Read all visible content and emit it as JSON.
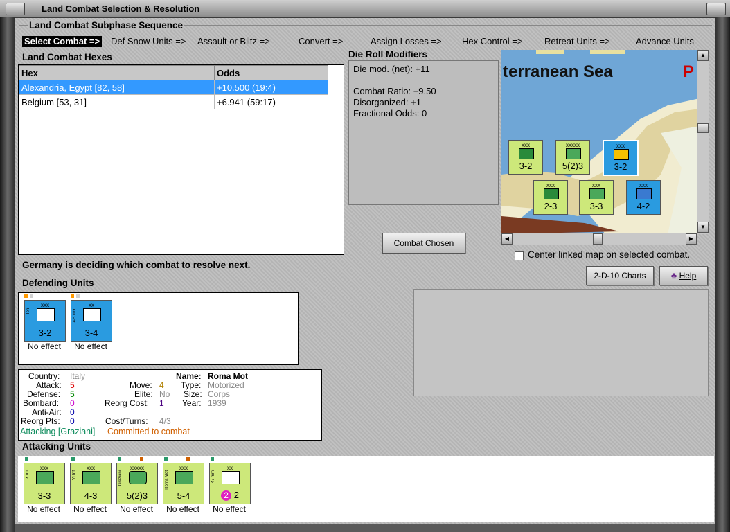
{
  "window": {
    "title": "Land Combat Selection & Resolution"
  },
  "subphase": {
    "title": "Land Combat Subphase Sequence",
    "steps": [
      "Select Combat =>",
      "Def Snow Units =>",
      "Assault or Blitz =>",
      "Convert =>",
      "Assign Losses =>",
      "Hex Control =>",
      "Retreat Units =>",
      "Advance Units"
    ]
  },
  "hexes": {
    "title": "Land Combat Hexes",
    "columns": [
      "Hex",
      "Odds"
    ],
    "rows": [
      {
        "hex": "Alexandria, Egypt [82, 58]",
        "odds": "+10.500 (19:4)"
      },
      {
        "hex": "Belgium [53, 31]",
        "odds": "+6.941 (59:17)"
      }
    ]
  },
  "die_roll": {
    "title": "Die Roll Modifiers",
    "net": "Die mod. (net): +11",
    "ratio": "Combat Ratio: +9.50",
    "disorganized": "Disorganized: +1",
    "fractional": "Fractional Odds: 0"
  },
  "map": {
    "label": "terranean Sea",
    "label2": "P",
    "stacks": [
      {
        "value": "3-2",
        "size": "xxx",
        "stack": "3"
      },
      {
        "value": "5(2)3",
        "size": "xxxxx",
        "stack": "3"
      },
      {
        "value": "3-2",
        "size": "xxx",
        "stack": "2"
      },
      {
        "value": "2-3",
        "size": "xxx",
        "stack": ""
      },
      {
        "value": "3-3",
        "size": "xxx",
        "stack": "2"
      },
      {
        "value": "4-2",
        "size": "xxx",
        "stack": "3"
      }
    ]
  },
  "buttons": {
    "combat_chosen": "Combat Chosen",
    "charts": "2-D-10 Charts",
    "help": "Help"
  },
  "center_map": {
    "label": "Center linked map on selected combat.",
    "checked": false
  },
  "status": "Germany is deciding which combat to resolve next.",
  "defending": {
    "title": "Defending Units",
    "units": [
      {
        "size": "xxx",
        "value": "3-2",
        "side": "Terr",
        "result": "No effect"
      },
      {
        "size": "xx",
        "value": "3-4",
        "side": "4-5 inch",
        "result": "No effect"
      }
    ]
  },
  "unit_info": {
    "country_label": "Country:",
    "country": "Italy",
    "attack_label": "Attack:",
    "attack": "5",
    "defense_label": "Defense:",
    "defense": "5",
    "bombard_label": "Bombard:",
    "bombard": "0",
    "antiair_label": "Anti-Air:",
    "antiair": "0",
    "reorg_label": "Reorg Pts:",
    "reorg": "0",
    "move_label": "Move:",
    "move": "4",
    "elite_label": "Elite:",
    "elite": "No",
    "reorgcost_label": "Reorg Cost:",
    "reorgcost": "1",
    "costturns_label": "Cost/Turns:",
    "costturns": "4/3",
    "name_label": "Name:",
    "name": "Roma Mot",
    "type_label": "Type:",
    "type": "Motorized",
    "size_label": "Size:",
    "size": "Corps",
    "year_label": "Year:",
    "year": "1939",
    "attacking": "Attacking [Graziani]",
    "committed": "Committed to combat"
  },
  "attacking": {
    "title": "Attacking Units",
    "units": [
      {
        "size": "xxx",
        "value": "3-3",
        "side": "X Inf",
        "result": "No effect"
      },
      {
        "size": "xxx",
        "value": "4-3",
        "side": "VI Inf",
        "result": "No effect"
      },
      {
        "size": "xxxxx",
        "value": "5(2)3",
        "side": "Graziani",
        "result": "No effect"
      },
      {
        "size": "xxx",
        "value": "5-4",
        "side": "Roma Mot",
        "result": "No effect"
      },
      {
        "size": "xx",
        "value": "2",
        "side": "47 mm",
        "badge": "2",
        "result": "No effect"
      }
    ]
  },
  "colors": {
    "selected_row": "#3399ff",
    "italy_counter": "#cde87a",
    "british_counter": "#2a9be0"
  }
}
